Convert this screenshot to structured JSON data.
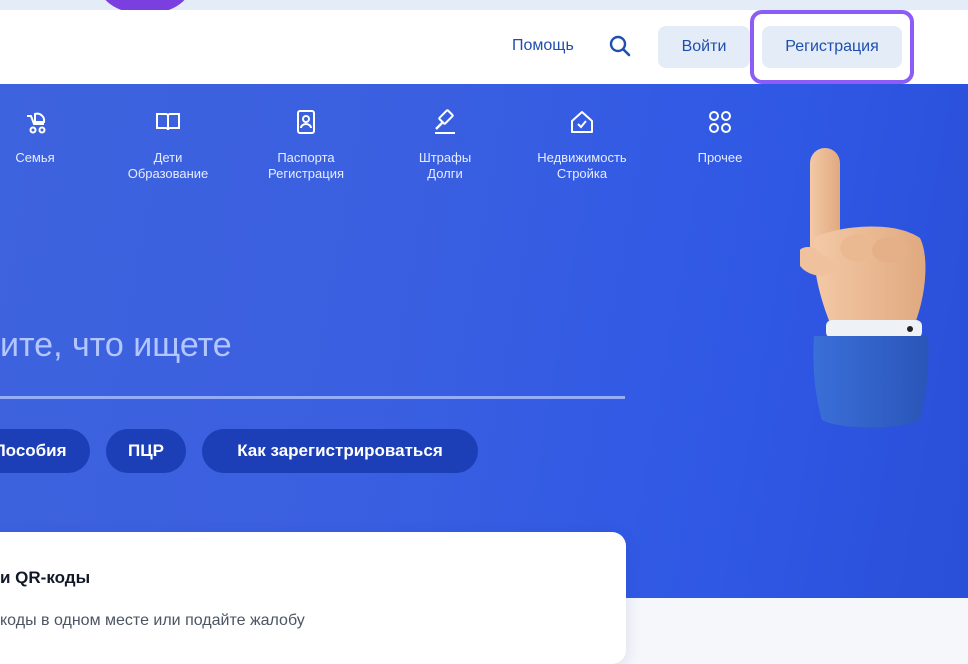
{
  "header": {
    "help_label": "Помощь",
    "login_label": "Войти",
    "register_label": "Регистрация"
  },
  "categories": [
    {
      "line1": "Семья",
      "line2": "",
      "icon": "stroller-icon"
    },
    {
      "line1": "Дети",
      "line2": "Образование",
      "icon": "book-icon"
    },
    {
      "line1": "Паспорта",
      "line2": "Регистрация",
      "icon": "passport-icon"
    },
    {
      "line1": "Штрафы",
      "line2": "Долги",
      "icon": "gavel-icon"
    },
    {
      "line1": "Недвижимость",
      "line2": "Стройка",
      "icon": "house-icon"
    },
    {
      "line1": "Прочее",
      "line2": "",
      "icon": "grid-icon"
    }
  ],
  "search": {
    "title": "ите, что ищете"
  },
  "chips": [
    {
      "label": "Пособия"
    },
    {
      "label": "ПЦР"
    },
    {
      "label": "Как зарегистрироваться"
    }
  ],
  "card": {
    "title": "и QR-коды",
    "description": "коды в одном месте или подайте жалобу"
  },
  "colors": {
    "hero_blue": "#3a5fe0",
    "chip_bg": "#1c3fb8",
    "button_bg": "#e4ecf8",
    "link_text": "#1f4fad",
    "highlight": "#8b5cf6"
  }
}
